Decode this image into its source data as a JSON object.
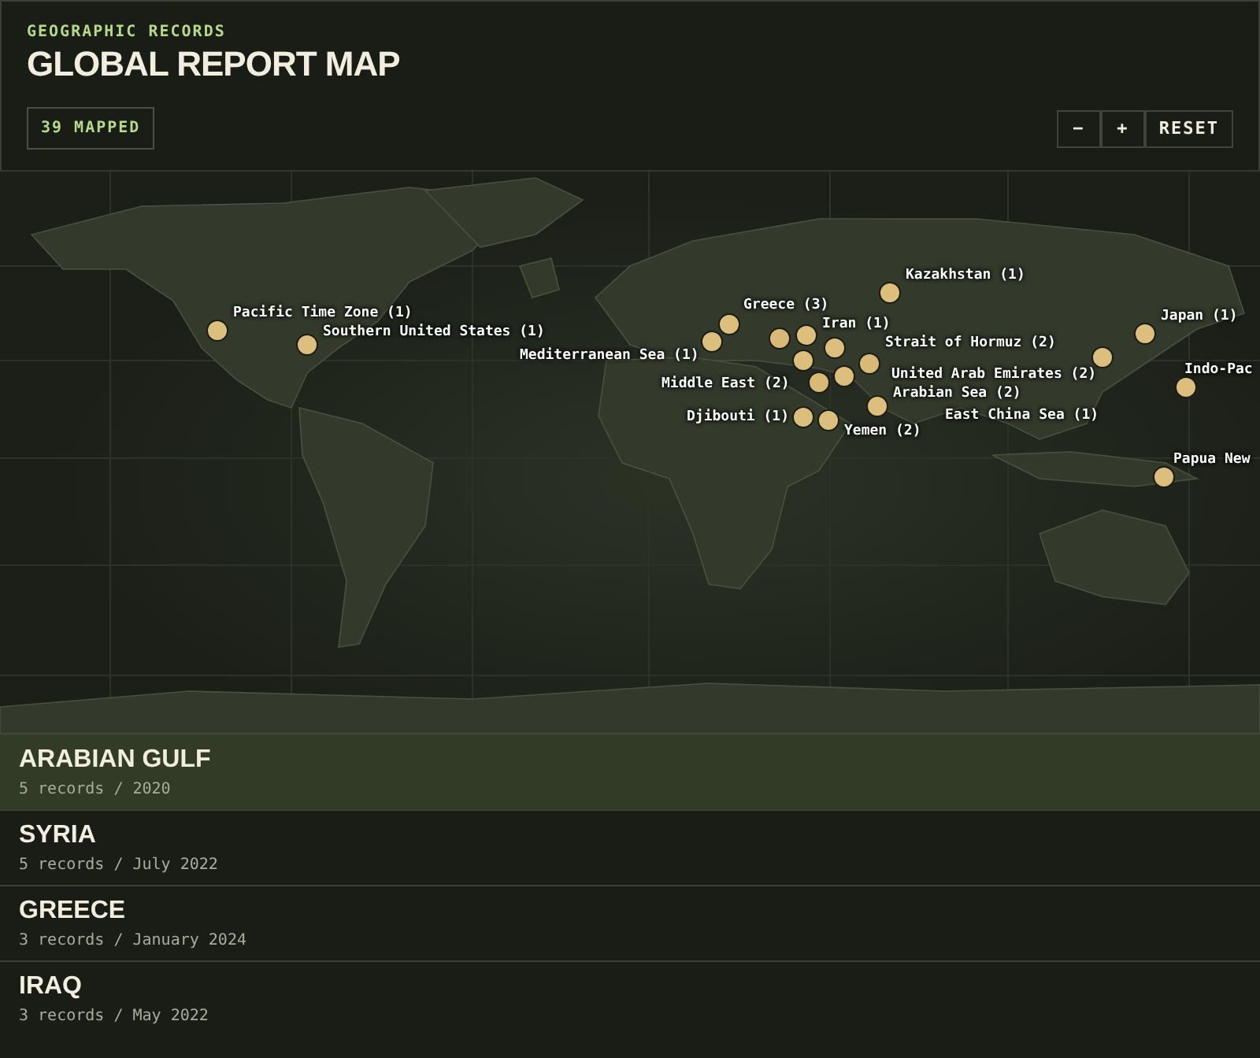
{
  "header": {
    "eyebrow": "GEOGRAPHIC RECORDS",
    "title": "GLOBAL REPORT MAP",
    "count_badge": "39 MAPPED",
    "zoom_controls": [
      "−",
      "+",
      "RESET"
    ]
  },
  "map": {
    "markers": [
      {
        "label": "Kazakhstan (1)"
      },
      {
        "label": "Greece (3)"
      },
      {
        "label": "Pacific Time Zone (1)"
      },
      {
        "label": "Japan (1)"
      },
      {
        "label": "Iran (1)"
      },
      {
        "label": "Southern United States (1)"
      },
      {
        "label": "Strait of Hormuz (2)"
      },
      {
        "label": "Mediterranean Sea (1)"
      },
      {
        "label": "Indo-Pac"
      },
      {
        "label": "United Arab Emirates (2)"
      },
      {
        "label": "Middle East (2)"
      },
      {
        "label": "Arabian Sea (2)"
      },
      {
        "label": "Djibouti (1)"
      },
      {
        "label": "East China Sea (1)"
      },
      {
        "label": "Yemen (2)"
      },
      {
        "label": "Papua New"
      },
      {
        "kind": "cluster"
      },
      {
        "kind": "cluster"
      },
      {
        "kind": "cluster"
      }
    ]
  },
  "locations": [
    {
      "name": "ARABIAN GULF",
      "detail": "5 records / 2020",
      "selected": true
    },
    {
      "name": "SYRIA",
      "detail": "5 records / July 2022",
      "selected": false
    },
    {
      "name": "GREECE",
      "detail": "3 records / January 2024",
      "selected": false
    },
    {
      "name": "IRAQ",
      "detail": "3 records / May 2022",
      "selected": false
    }
  ]
}
